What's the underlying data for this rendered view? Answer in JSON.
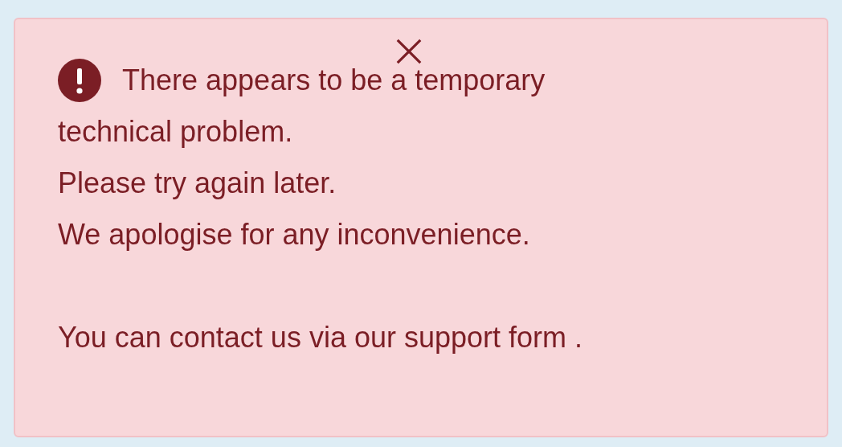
{
  "alert": {
    "kind": "error",
    "message": "There appears to be a temporary",
    "lines": [
      "technical problem.",
      "Please try again later.",
      "We apologise for any inconvenience."
    ],
    "contact": {
      "before": "You can contact us via our ",
      "link": "support form",
      "after": " ."
    }
  }
}
